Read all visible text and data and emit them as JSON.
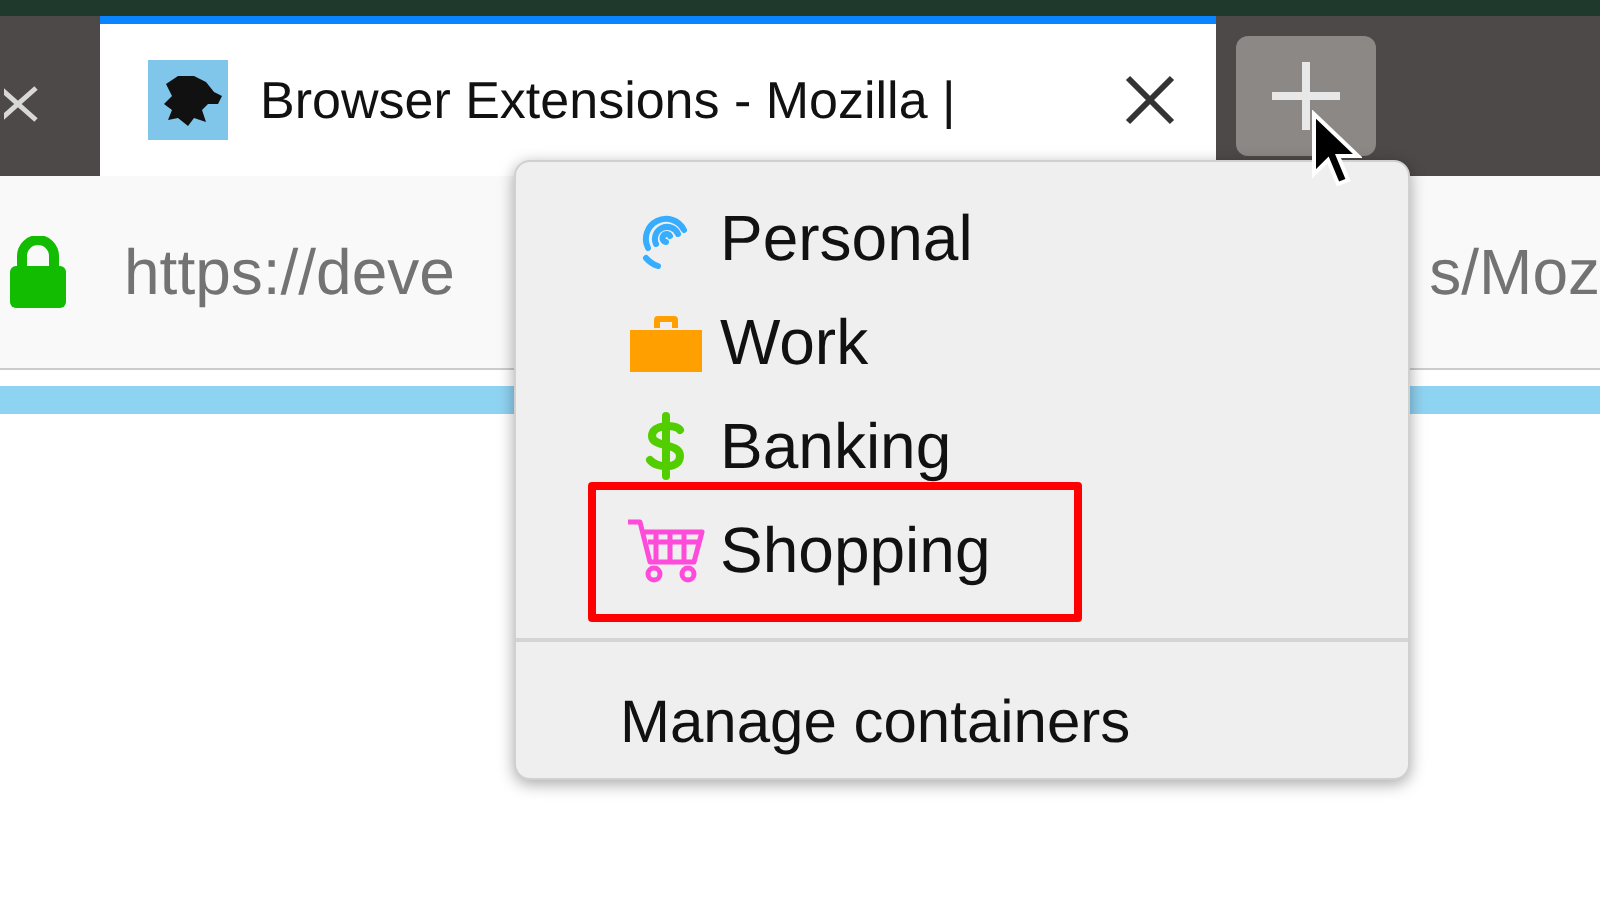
{
  "tabs": [
    {
      "title": "Browser Extensions - Mozilla |",
      "selected": true
    }
  ],
  "address_bar": {
    "url_start": "https://deve",
    "url_end": "s/Moz",
    "secure": true
  },
  "container_menu": {
    "items": [
      {
        "label": "Personal",
        "kind": "fingerprint",
        "color": "#37adff",
        "selected": false
      },
      {
        "label": "Work",
        "kind": "briefcase",
        "color": "#ff9f00",
        "selected": false
      },
      {
        "label": "Banking",
        "kind": "dollar",
        "color": "#51cd00",
        "selected": false
      },
      {
        "label": "Shopping",
        "kind": "cart",
        "color": "#ff4bda",
        "selected": true
      }
    ],
    "footer": "Manage containers"
  }
}
